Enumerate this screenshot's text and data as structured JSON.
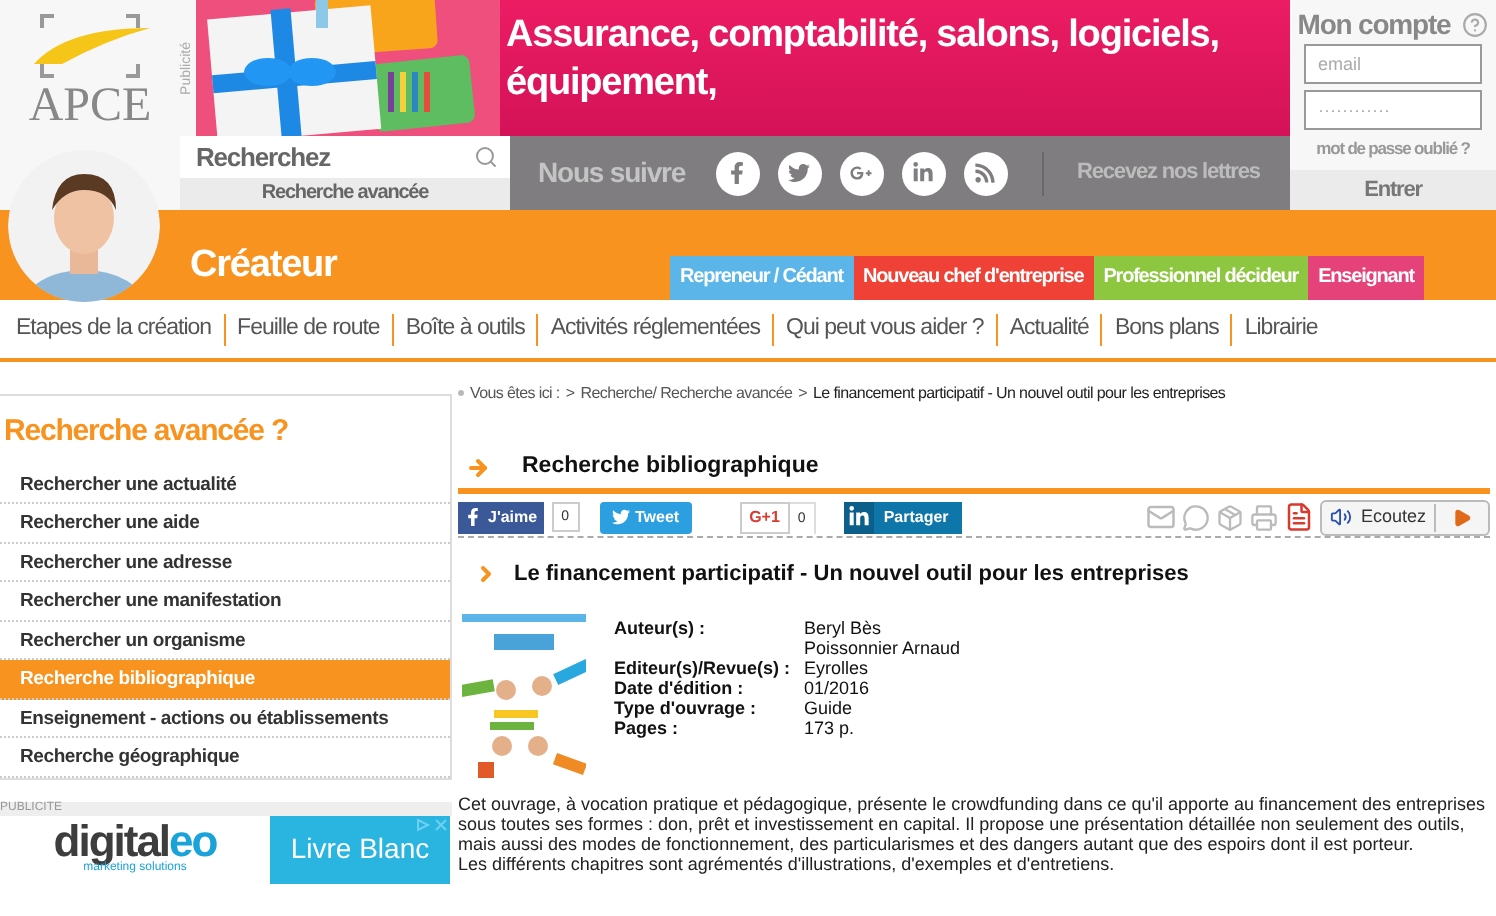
{
  "logo": {
    "text": "APCE"
  },
  "ad_label": "Publicité",
  "ad_banner": {
    "headline": "Assurance, comptabilité, salons, logiciels, équipement,"
  },
  "account": {
    "title": "Mon compte",
    "email_placeholder": "email",
    "password_placeholder": "············",
    "forgot": "mot de passe oublié ?",
    "submit": "Entrer"
  },
  "search": {
    "placeholder": "Recherchez",
    "advanced": "Recherche avancée"
  },
  "social": {
    "label": "Nous suivre",
    "newsletter": "Recevez nos lettres"
  },
  "profile": {
    "title": "Créateur"
  },
  "profile_tabs": [
    {
      "label": "Repreneur / Cédant",
      "color": "#5bb5e8"
    },
    {
      "label": "Nouveau chef d'entreprise",
      "color": "#ef4136"
    },
    {
      "label": "Professionnel décideur",
      "color": "#8dc63f"
    },
    {
      "label": "Enseignant",
      "color": "#e6427a"
    }
  ],
  "nav": [
    "Etapes de la création",
    "Feuille de route",
    "Boîte à outils",
    "Activités réglementées",
    "Qui peut vous aider ?",
    "Actualité",
    "Bons plans",
    "Librairie"
  ],
  "sidebar": {
    "title": "Recherche avancée ?",
    "items": [
      {
        "label": "Rechercher une actualité",
        "selected": false
      },
      {
        "label": "Rechercher une aide",
        "selected": false
      },
      {
        "label": "Rechercher une adresse",
        "selected": false
      },
      {
        "label": "Rechercher une manifestation",
        "selected": false
      },
      {
        "label": "Rechercher un organisme",
        "selected": false
      },
      {
        "label": "Recherche bibliographique",
        "selected": true
      },
      {
        "label": "Enseignement - actions ou établissements",
        "selected": false
      },
      {
        "label": "Recherche géographique",
        "selected": false
      }
    ]
  },
  "sidebar_ad": {
    "label": "PUBLICITE",
    "brand": [
      "digital",
      "eo"
    ],
    "tagline": "marketing solutions",
    "cta": "Livre Blanc"
  },
  "breadcrumb": {
    "label": "Vous êtes ici :",
    "separator": ">",
    "links": [
      "Recherche/ Recherche avancée",
      "Le financement participatif - Un nouvel outil pour les entreprises"
    ]
  },
  "section_title": "Recherche bibliographique",
  "share": {
    "like": "J'aime",
    "like_count": "0",
    "tweet": "Tweet",
    "gplus": "G+1",
    "gplus_count": "0",
    "linkedin": "Partager",
    "listen": "Ecoutez"
  },
  "article": {
    "title": "Le financement participatif - Un nouvel outil pour les entreprises",
    "fields": [
      {
        "label": "Auteur(s) :",
        "values": [
          "Beryl Bès",
          "Poissonnier Arnaud"
        ]
      },
      {
        "label": "Editeur(s)/Revue(s) :",
        "values": [
          "Eyrolles"
        ]
      },
      {
        "label": "Date d'édition :",
        "values": [
          "01/2016"
        ]
      },
      {
        "label": "Type d'ouvrage :",
        "values": [
          "Guide"
        ]
      },
      {
        "label": "Pages :",
        "values": [
          "173 p."
        ]
      }
    ],
    "description": [
      "Cet ouvrage, à vocation pratique et pédagogique, présente le crowdfunding dans ce qu'il apporte au financement des entreprises sous toutes ses formes : don, prêt et investissement en capital. Il propose une présentation détaillée non seulement des outils, mais aussi des modes de fonctionnement, des particularismes et des dangers autant que des espoirs dont il est porteur.",
      "Les différents chapitres sont agrémentés d'illustrations, d'exemples et d'entretiens."
    ]
  }
}
